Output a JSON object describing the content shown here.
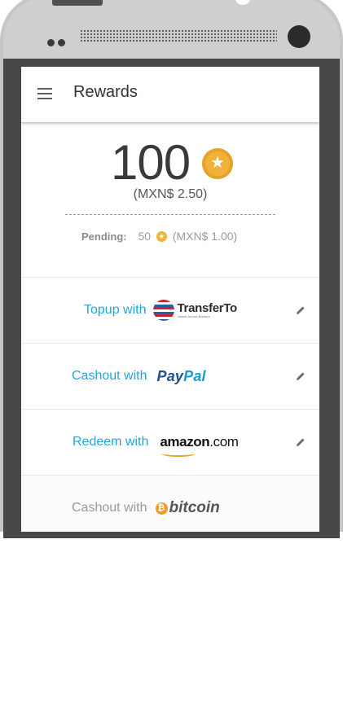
{
  "app": {
    "title": "Rewards"
  },
  "balance": {
    "points": "100",
    "fiat": "(MXN$ 2.50)"
  },
  "pending": {
    "label": "Pending:",
    "points": "50",
    "fiat": "(MXN$ 1.00)"
  },
  "options": [
    {
      "label": "Topup with",
      "brand": "TransferTo",
      "brand_tagline": "Values Across Borders",
      "editable": true
    },
    {
      "label": "Cashout with",
      "brand_part1": "Pay",
      "brand_part2": "Pal",
      "editable": true
    },
    {
      "label": "Redeem with",
      "brand_part1": "amazon",
      "brand_part2": ".com",
      "editable": true
    },
    {
      "label": "Cashout with",
      "brand_symbol": "₿",
      "brand": "bitcoin",
      "editable": false
    }
  ],
  "colors": {
    "accent": "#20a6df",
    "coin": "#f0b23b",
    "phone_frame": "#c6c6c6",
    "bezel": "#474747"
  },
  "icons": {
    "menu": "menu-icon",
    "coin": "star-coin-icon",
    "edit": "pencil-icon"
  }
}
